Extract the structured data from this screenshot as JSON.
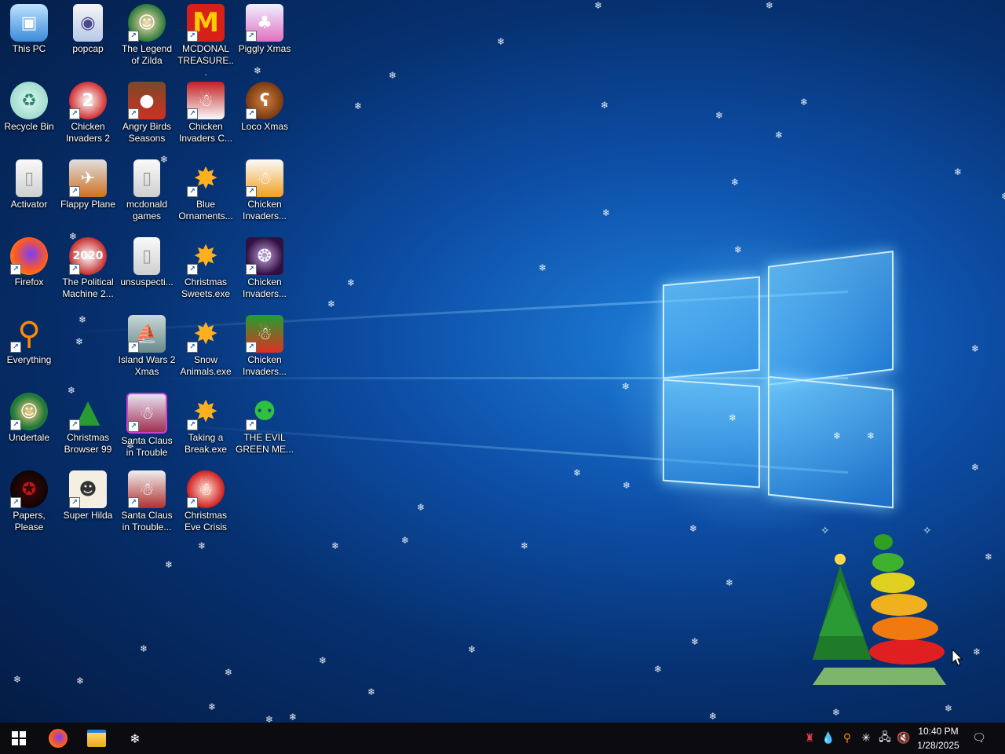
{
  "desktop": {
    "icons": [
      {
        "label": "This PC"
      },
      {
        "label": "popcap"
      },
      {
        "label": "The Legend of Zilda"
      },
      {
        "label": "MCDONAL TREASURE..."
      },
      {
        "label": "Piggly Xmas"
      },
      {
        "label": "Recycle Bin"
      },
      {
        "label": "Chicken Invaders 2"
      },
      {
        "label": "Angry Birds Seasons"
      },
      {
        "label": "Chicken Invaders C..."
      },
      {
        "label": "Loco Xmas"
      },
      {
        "label": "Activator"
      },
      {
        "label": "Flappy Plane"
      },
      {
        "label": "mcdonald games"
      },
      {
        "label": "Blue Ornaments..."
      },
      {
        "label": "Chicken Invaders..."
      },
      {
        "label": "Firefox"
      },
      {
        "label": "The Political Machine 2..."
      },
      {
        "label": "unsuspecti..."
      },
      {
        "label": "Christmas Sweets.exe"
      },
      {
        "label": "Chicken Invaders..."
      },
      {
        "label": "Everything"
      },
      {
        "label": "Island Wars 2 Xmas"
      },
      {
        "label": "Snow Animals.exe"
      },
      {
        "label": "Chicken Invaders..."
      },
      {
        "label": "Undertale"
      },
      {
        "label": "Christmas Browser 99"
      },
      {
        "label": "Santa Claus in Trouble"
      },
      {
        "label": "Taking a Break.exe"
      },
      {
        "label": "THE EVIL GREEN ME..."
      },
      {
        "label": "Papers, Please"
      },
      {
        "label": "Super Hilda"
      },
      {
        "label": "Santa Claus in Trouble..."
      },
      {
        "label": "Christmas Eve Crisis"
      }
    ]
  },
  "taskbar": {
    "clock": {
      "time": "10:40 PM",
      "date": "1/28/2025"
    }
  },
  "colors": {
    "accent": "#1e7fd8",
    "taskbar": "#0b0b10"
  }
}
